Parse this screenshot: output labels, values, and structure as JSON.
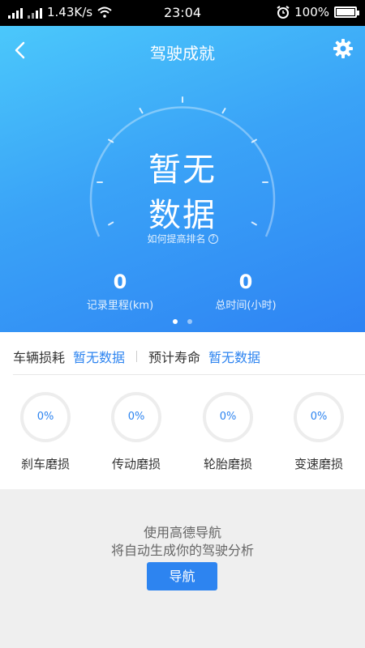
{
  "status_bar": {
    "network_speed": "1.43K/s",
    "time": "23:04",
    "battery": "100%",
    "battery_level": 1.0
  },
  "header": {
    "title": "驾驶成就",
    "back_icon": "back-arrow-icon",
    "settings_icon": "gear-icon"
  },
  "gauge": {
    "center_text_line1": "暂无",
    "center_text_line2": "数据",
    "rank_link": "如何提高排名",
    "help_icon": "question-circle-icon"
  },
  "stats": [
    {
      "value": "0",
      "label": "记录里程(km)"
    },
    {
      "value": "0",
      "label": "总时间(小时)"
    }
  ],
  "pager": {
    "pages": 2,
    "active": 0
  },
  "wear_summary": {
    "consumption_label": "车辆损耗",
    "consumption_value": "暂无数据",
    "life_label": "预计寿命",
    "life_value": "暂无数据"
  },
  "wear_items": [
    {
      "percent": "0%",
      "name": "刹车磨损"
    },
    {
      "percent": "0%",
      "name": "传动磨损"
    },
    {
      "percent": "0%",
      "name": "轮胎磨损"
    },
    {
      "percent": "0%",
      "name": "变速磨损"
    }
  ],
  "promo": {
    "line1": "使用高德导航",
    "line2": "将自动生成你的驾驶分析",
    "button": "导航"
  },
  "colors": {
    "accent": "#2d84f0",
    "hero_gradient_start": "#4bc8fb",
    "hero_gradient_end": "#2e83f3"
  }
}
